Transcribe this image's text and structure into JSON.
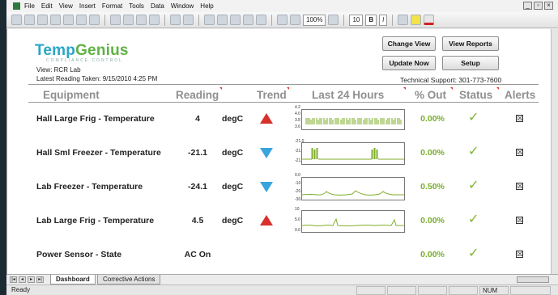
{
  "menu": [
    "File",
    "Edit",
    "View",
    "Insert",
    "Format",
    "Tools",
    "Data",
    "Window",
    "Help"
  ],
  "toolbar": {
    "zoom": "100%",
    "font_size": "10",
    "bold": "B",
    "italic": "I"
  },
  "header": {
    "logo_primary": "Temp",
    "logo_secondary": "Genius",
    "logo_tagline": "COMPLIANCE CONTROL",
    "view_label": "View: RCR Lab",
    "latest_reading": "Latest Reading Taken: 9/15/2010 4:25 PM",
    "support": "Technical Support: 301-773-7600"
  },
  "buttons": {
    "change_view": "Change View",
    "view_reports": "View Reports",
    "update_now": "Update Now",
    "setup": "Setup"
  },
  "columns": {
    "equipment": "Equipment",
    "reading": "Reading",
    "trend": "Trend",
    "last24": "Last 24 Hours",
    "pct_out": "% Out",
    "status": "Status",
    "alerts": "Alerts"
  },
  "rows": [
    {
      "name": "Hall Large Frig - Temperature",
      "reading": "4",
      "unit": "degC",
      "trend": "up",
      "pct_out": "0.00%",
      "status": "✓",
      "alert": "☒",
      "spark_axis": [
        "4.2",
        "4.0",
        "3.8",
        "3.6"
      ]
    },
    {
      "name": "Hall Sml Freezer - Temperature",
      "reading": "-21.1",
      "unit": "degC",
      "trend": "down",
      "pct_out": "0.00%",
      "status": "✓",
      "alert": "☒",
      "spark_axis": [
        "-21.0",
        "-21.2",
        "-21.4"
      ]
    },
    {
      "name": "Lab Freezer - Temperature",
      "reading": "-24.1",
      "unit": "degC",
      "trend": "down",
      "pct_out": "0.50%",
      "status": "✓",
      "alert": "☒",
      "spark_axis": [
        "0.0",
        "-10.0",
        "-20.0",
        "-30.0"
      ]
    },
    {
      "name": "Lab Large Frig - Temperature",
      "reading": "4.5",
      "unit": "degC",
      "trend": "up",
      "pct_out": "0.00%",
      "status": "✓",
      "alert": "☒",
      "spark_axis": [
        "10",
        "5.0",
        "0.0"
      ]
    },
    {
      "name": "Power Sensor - State",
      "reading": "AC On",
      "unit": "",
      "trend": "",
      "pct_out": "0.00%",
      "status": "✓",
      "alert": "☒",
      "spark_axis": []
    }
  ],
  "sheet_tabs": {
    "dashboard": "Dashboard",
    "corrective": "Corrective Actions"
  },
  "status": {
    "ready": "Ready",
    "num": "NUM"
  },
  "colors": {
    "trend_up": "#d8312c",
    "trend_down": "#39a5dc",
    "ok_green": "#7fb32e",
    "logo_blue": "#29a6c8",
    "logo_green": "#5fb144"
  }
}
